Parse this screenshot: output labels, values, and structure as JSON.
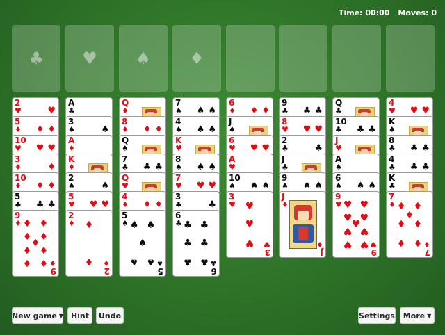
{
  "status": {
    "time_label": "Time: 00:00",
    "moves_label": "Moves: 0"
  },
  "slots": [
    {
      "icon": "club-icon",
      "glyph": "♣"
    },
    {
      "icon": "heart-icon",
      "glyph": "♥"
    },
    {
      "icon": "spade-icon",
      "glyph": "♠"
    },
    {
      "icon": "diamond-icon",
      "glyph": "♦"
    },
    {
      "icon": "",
      "glyph": ""
    },
    {
      "icon": "",
      "glyph": ""
    },
    {
      "icon": "",
      "glyph": ""
    },
    {
      "icon": "",
      "glyph": ""
    }
  ],
  "columns": [
    [
      {
        "rank": "2",
        "suit": "hearts"
      },
      {
        "rank": "5",
        "suit": "diamonds"
      },
      {
        "rank": "10",
        "suit": "hearts"
      },
      {
        "rank": "3",
        "suit": "diamonds"
      },
      {
        "rank": "10",
        "suit": "diamonds"
      },
      {
        "rank": "5",
        "suit": "clubs"
      },
      {
        "rank": "9",
        "suit": "diamonds"
      }
    ],
    [
      {
        "rank": "A",
        "suit": "clubs"
      },
      {
        "rank": "3",
        "suit": "spades"
      },
      {
        "rank": "A",
        "suit": "diamonds"
      },
      {
        "rank": "K",
        "suit": "diamonds"
      },
      {
        "rank": "2",
        "suit": "spades"
      },
      {
        "rank": "5",
        "suit": "hearts"
      },
      {
        "rank": "2",
        "suit": "diamonds"
      }
    ],
    [
      {
        "rank": "Q",
        "suit": "diamonds"
      },
      {
        "rank": "8",
        "suit": "diamonds"
      },
      {
        "rank": "Q",
        "suit": "spades"
      },
      {
        "rank": "7",
        "suit": "clubs"
      },
      {
        "rank": "Q",
        "suit": "hearts"
      },
      {
        "rank": "4",
        "suit": "diamonds"
      },
      {
        "rank": "5",
        "suit": "spades"
      }
    ],
    [
      {
        "rank": "7",
        "suit": "spades"
      },
      {
        "rank": "4",
        "suit": "spades"
      },
      {
        "rank": "K",
        "suit": "hearts"
      },
      {
        "rank": "8",
        "suit": "spades"
      },
      {
        "rank": "7",
        "suit": "hearts"
      },
      {
        "rank": "3",
        "suit": "clubs"
      },
      {
        "rank": "6",
        "suit": "clubs"
      }
    ],
    [
      {
        "rank": "6",
        "suit": "diamonds"
      },
      {
        "rank": "J",
        "suit": "spades"
      },
      {
        "rank": "6",
        "suit": "hearts"
      },
      {
        "rank": "A",
        "suit": "hearts"
      },
      {
        "rank": "10",
        "suit": "spades"
      },
      {
        "rank": "3",
        "suit": "hearts"
      }
    ],
    [
      {
        "rank": "9",
        "suit": "clubs"
      },
      {
        "rank": "8",
        "suit": "hearts"
      },
      {
        "rank": "2",
        "suit": "clubs"
      },
      {
        "rank": "J",
        "suit": "clubs"
      },
      {
        "rank": "9",
        "suit": "spades"
      },
      {
        "rank": "J",
        "suit": "diamonds"
      }
    ],
    [
      {
        "rank": "Q",
        "suit": "clubs"
      },
      {
        "rank": "10",
        "suit": "clubs"
      },
      {
        "rank": "J",
        "suit": "hearts"
      },
      {
        "rank": "A",
        "suit": "spades"
      },
      {
        "rank": "6",
        "suit": "spades"
      },
      {
        "rank": "9",
        "suit": "hearts"
      }
    ],
    [
      {
        "rank": "4",
        "suit": "hearts"
      },
      {
        "rank": "K",
        "suit": "spades"
      },
      {
        "rank": "8",
        "suit": "clubs"
      },
      {
        "rank": "4",
        "suit": "clubs"
      },
      {
        "rank": "K",
        "suit": "clubs"
      },
      {
        "rank": "7",
        "suit": "diamonds"
      }
    ]
  ],
  "buttons": {
    "new_game": "New game",
    "hint": "Hint",
    "undo": "Undo",
    "settings": "Settings",
    "more": "More"
  },
  "colors": {
    "felt": "#2e7328",
    "red_suit": "#e00d14",
    "black_suit": "#0b0b0b"
  }
}
